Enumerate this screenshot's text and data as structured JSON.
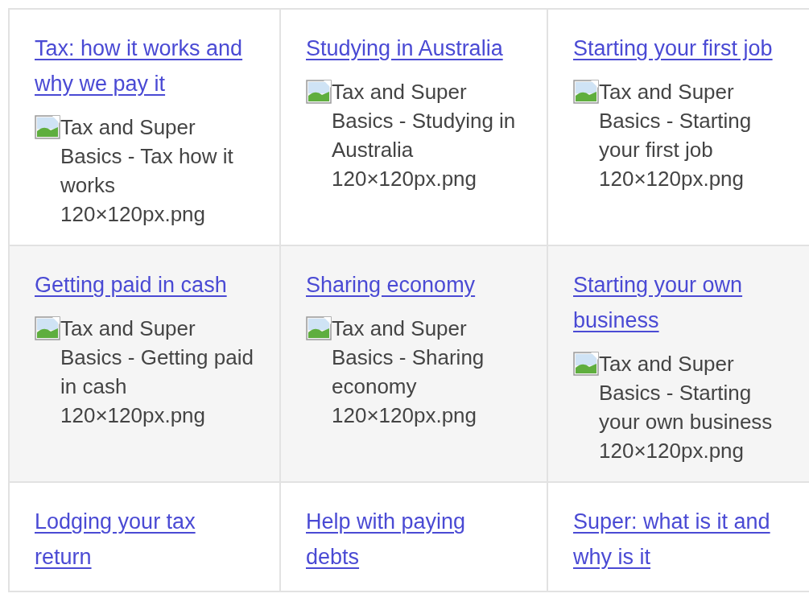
{
  "grid": {
    "rows": [
      {
        "cells": [
          {
            "link": "Tax: how it works and why we pay it",
            "image_alt": "Tax and Super Basics - Tax how it works 120×120px.png"
          },
          {
            "link": "Studying in Australia",
            "image_alt": "Tax and Super Basics - Studying in Australia 120×120px.png"
          },
          {
            "link": "Starting your first job",
            "image_alt": "Tax and Super Basics - Starting your first job 120×120px.png"
          }
        ]
      },
      {
        "cells": [
          {
            "link": "Getting paid in cash",
            "image_alt": "Tax and Super Basics - Getting paid in cash 120×120px.png"
          },
          {
            "link": "Sharing economy",
            "image_alt": "Tax and Super Basics - Sharing economy 120×120px.png"
          },
          {
            "link": "Starting your own business",
            "image_alt": "Tax and Super Basics - Starting your own business 120×120px.png"
          }
        ]
      },
      {
        "cells": [
          {
            "link": "Lodging your tax return"
          },
          {
            "link": "Help with paying debts"
          },
          {
            "link": "Super: what is it and why is it"
          }
        ]
      }
    ]
  }
}
